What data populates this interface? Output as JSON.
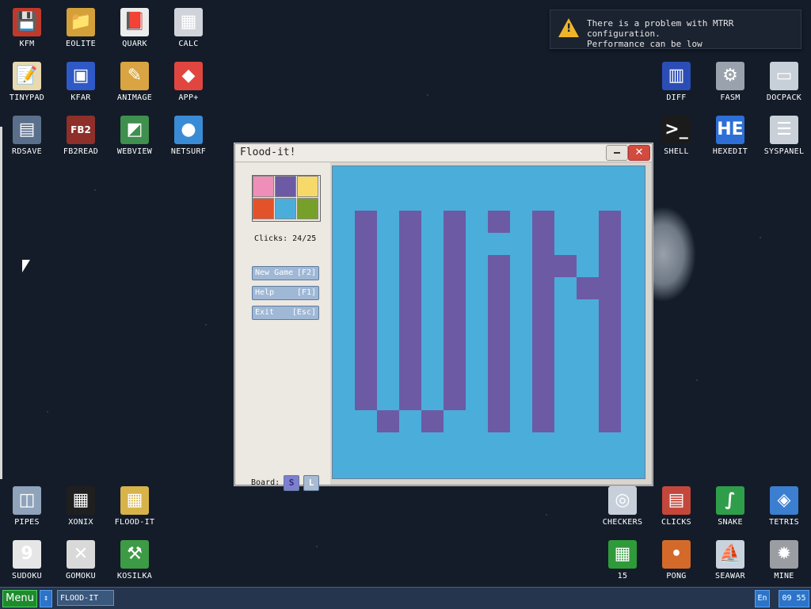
{
  "desktop": {
    "icons": [
      {
        "label": "KFM",
        "glyph": "💾",
        "color": "#c0392b",
        "name": "kfm-icon"
      },
      {
        "label": "EOLITE",
        "glyph": "📁",
        "color": "#d4a03a",
        "name": "eolite-icon"
      },
      {
        "label": "QUARK",
        "glyph": "📕",
        "color": "#ececec",
        "name": "quark-icon"
      },
      {
        "label": "CALC",
        "glyph": "▦",
        "color": "#d0d4da",
        "name": "calc-icon"
      },
      {
        "label": "TINYPAD",
        "glyph": "📝",
        "color": "#e8d9b0",
        "name": "tinypad-icon"
      },
      {
        "label": "KFAR",
        "glyph": "▣",
        "color": "#2e59c6",
        "name": "kfar-icon"
      },
      {
        "label": "ANIMAGE",
        "glyph": "✎",
        "color": "#d9a441",
        "name": "animage-icon"
      },
      {
        "label": "APP+",
        "glyph": "◆",
        "color": "#e0463f",
        "name": "app-plus-icon"
      },
      {
        "label": "RDSAVE",
        "glyph": "▤",
        "color": "#5a6f8c",
        "name": "rdsave-icon"
      },
      {
        "label": "FB2READ",
        "glyph": "FB2",
        "color": "#8e2f2a",
        "name": "fb2read-icon"
      },
      {
        "label": "WEBVIEW",
        "glyph": "◩",
        "color": "#3f8f4e",
        "name": "webview-icon"
      },
      {
        "label": "NETSURF",
        "glyph": "●",
        "color": "#3a8bd6",
        "name": "netsurf-icon"
      },
      {
        "label": "DIFF",
        "glyph": "▥",
        "color": "#2b4db5",
        "name": "diff-icon"
      },
      {
        "label": "FASM",
        "glyph": "⚙",
        "color": "#9aa3ad",
        "name": "fasm-icon"
      },
      {
        "label": "DOCPACK",
        "glyph": "▭",
        "color": "#c7cfd8",
        "name": "docpack-icon"
      },
      {
        "label": "SHELL",
        "glyph": ">_",
        "color": "#1b1b1b",
        "name": "shell-icon"
      },
      {
        "label": "HEXEDIT",
        "glyph": "HE",
        "color": "#2d6fd6",
        "name": "hexedit-icon"
      },
      {
        "label": "SYSPANEL",
        "glyph": "☰",
        "color": "#c9d0d8",
        "name": "syspanel-icon"
      },
      {
        "label": "PIPES",
        "glyph": "◫",
        "color": "#8fa3ba",
        "name": "pipes-icon"
      },
      {
        "label": "XONIX",
        "glyph": "▦",
        "color": "#1f1f1f",
        "name": "xonix-icon"
      },
      {
        "label": "FLOOD-IT",
        "glyph": "▦",
        "color": "#d7b34a",
        "name": "flood-it-icon"
      },
      {
        "label": "CHECKERS",
        "glyph": "◎",
        "color": "#c7d0da",
        "name": "checkers-icon"
      },
      {
        "label": "CLICKS",
        "glyph": "▤",
        "color": "#c4473c",
        "name": "clicks-icon"
      },
      {
        "label": "SNAKE",
        "glyph": "∫",
        "color": "#2f9e4a",
        "name": "snake-icon"
      },
      {
        "label": "TETRIS",
        "glyph": "◈",
        "color": "#3c7fd1",
        "name": "tetris-icon"
      },
      {
        "label": "SUDOKU",
        "glyph": "9",
        "color": "#e6e6e6",
        "name": "sudoku-icon"
      },
      {
        "label": "GOMOKU",
        "glyph": "✕",
        "color": "#d9d9d9",
        "name": "gomoku-icon"
      },
      {
        "label": "KOSILKA",
        "glyph": "⚒",
        "color": "#3d9a45",
        "name": "kosilka-icon"
      },
      {
        "label": "15",
        "glyph": "▦",
        "color": "#2f9a3a",
        "name": "fifteen-icon"
      },
      {
        "label": "PONG",
        "glyph": "•",
        "color": "#d36a2a",
        "name": "pong-icon"
      },
      {
        "label": "SEAWAR",
        "glyph": "⛵",
        "color": "#c9d3dd",
        "name": "seawar-icon"
      },
      {
        "label": "MINE",
        "glyph": "✹",
        "color": "#9a9ea3",
        "name": "mine-icon"
      }
    ]
  },
  "notification": {
    "line1": "There is a problem with MTRR configuration.",
    "line2": "Performance can be low",
    "icon": "warning-icon"
  },
  "window": {
    "title": "Flood-it!",
    "minimize_icon": "minimize-icon",
    "close_icon": "close-icon",
    "close_glyph": "✕",
    "palette": [
      "#ef8fb9",
      "#6c5aa5",
      "#f7d96a",
      "#e2522b",
      "#4badda",
      "#77a02a"
    ],
    "clicks_text": "Clicks: 24/25",
    "buttons": [
      {
        "label": "New Game",
        "key": "[F2]"
      },
      {
        "label": "Help",
        "key": "[F1]"
      },
      {
        "label": "Exit",
        "key": "[Esc]"
      }
    ],
    "board_label": "Board:",
    "size_small": "S",
    "size_large": "L",
    "board_colors": {
      "background": "#4badda",
      "foreground": "#6c5aa5"
    }
  },
  "taskbar": {
    "menu_label": "Menu",
    "arrow_glyph": "↕",
    "task_label": "FLOOD-IT",
    "lang": "En",
    "time": "09 55"
  }
}
